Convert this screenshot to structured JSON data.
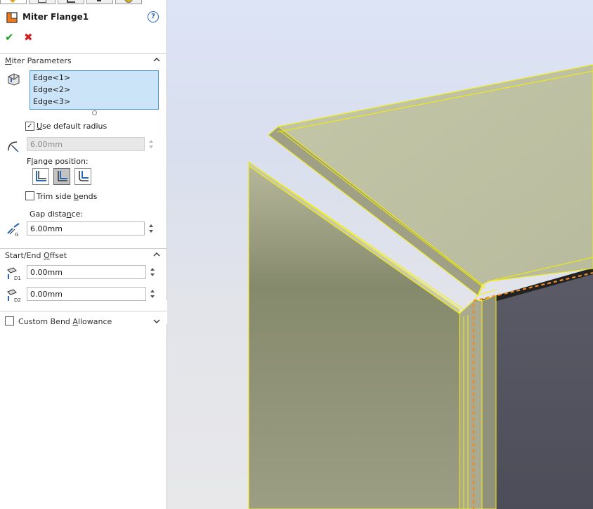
{
  "window": {
    "title": "Miter Flange1"
  },
  "tabs": [
    {
      "icon": "feature-manager-icon",
      "active": true
    },
    {
      "icon": "property-manager-icon",
      "active": false
    },
    {
      "icon": "configuration-manager-icon",
      "active": false
    },
    {
      "icon": "dimxpert-icon",
      "active": false
    },
    {
      "icon": "display-manager-icon",
      "active": false
    }
  ],
  "colors": {
    "accent_blue": "#4f95d6",
    "selection_fill": "#cce4f7",
    "ok_green": "#22a02a",
    "cancel_red": "#d22020",
    "highlight_yellow": "#f4f000",
    "preview_orange": "#f08a24"
  },
  "help": {
    "label": "?"
  },
  "actions": {
    "ok_glyph": "✔",
    "cancel_glyph": "✖"
  },
  "miter_parameters": {
    "heading_pre": "",
    "heading_key": "M",
    "heading_post": "iter Parameters",
    "edges": [
      "Edge<1>",
      "Edge<2>",
      "Edge<3>"
    ],
    "use_default_radius": {
      "checked": true,
      "label_key": "U",
      "label_rest": "se default radius"
    },
    "radius": {
      "value": "6.00mm",
      "disabled": true
    },
    "flange_position": {
      "label_pre": "F",
      "label_key": "l",
      "label_post": "ange position:",
      "options": [
        "material-inside-icon",
        "material-outside-icon",
        "bend-outside-icon"
      ],
      "selected_index": 1
    },
    "trim_side_bends": {
      "checked": false,
      "label_pre": "Trim side ",
      "label_key": "b",
      "label_post": "ends"
    },
    "gap_distance": {
      "label_pre": "Gap dista",
      "label_key": "n",
      "label_post": "ce:",
      "value": "6.00mm"
    }
  },
  "start_end_offset": {
    "heading_pre": "Start/End ",
    "heading_key": "O",
    "heading_post": "ffset",
    "start_offset": {
      "icon_sub": "D1",
      "value": "0.00mm"
    },
    "end_offset": {
      "icon_sub": "D2",
      "value": "0.00mm"
    }
  },
  "custom_bend_allowance": {
    "checked": false,
    "label_pre": "Custom Bend ",
    "label_key": "A",
    "label_post": "llowance"
  }
}
